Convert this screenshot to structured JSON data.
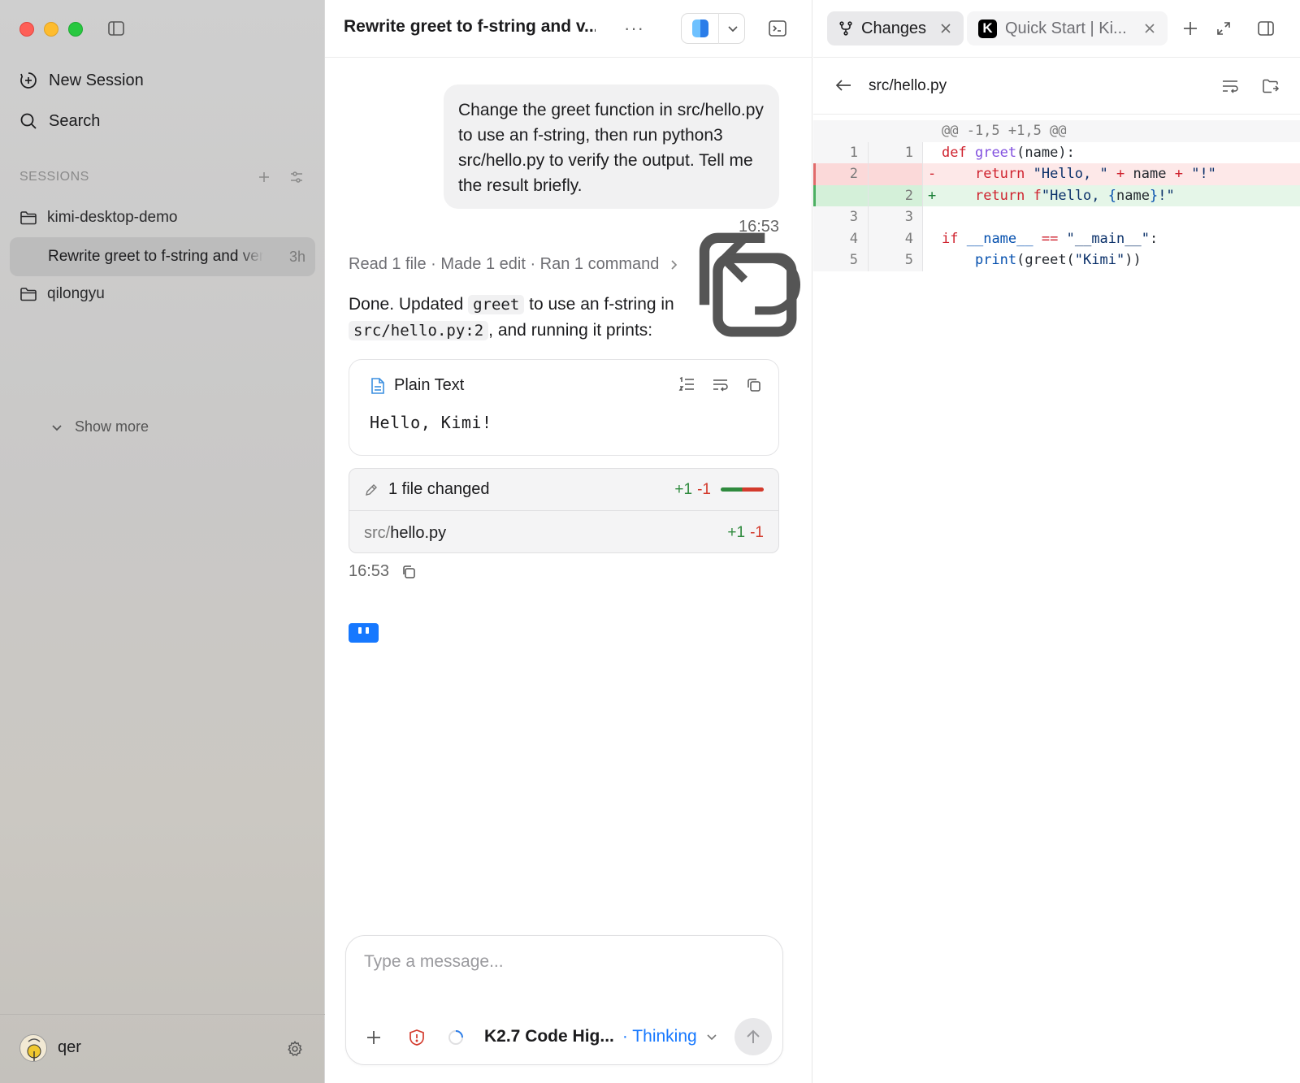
{
  "sidebar": {
    "new_session": "New Session",
    "search": "Search",
    "sessions_label": "SESSIONS",
    "folders": [
      {
        "name": "kimi-desktop-demo"
      },
      {
        "name": "qilongyu"
      }
    ],
    "active_session": {
      "title": "Rewrite greet to f-string and verify",
      "age": "3h"
    },
    "show_more": "Show more",
    "user": {
      "name": "qer"
    }
  },
  "chat": {
    "title": "Rewrite greet to f-string and v...",
    "more": "···",
    "user_message": "Change the greet function in src/hello.py to use an f-string, then run python3 src/hello.py to verify the output. Tell me the result briefly.",
    "user_message_time": "16:53",
    "activity": "Read 1 file · Made 1 edit · Ran 1 command",
    "reply": {
      "part1": "Done. Updated ",
      "code1": "greet",
      "part2": " to use an f-string in ",
      "code2": "src/hello.py:2",
      "part3": ", and running it prints:"
    },
    "code_block": {
      "language": "Plain Text",
      "content": "Hello, Kimi!"
    },
    "files_changed": {
      "title": "1 file changed",
      "additions": "+1",
      "deletions": "-1",
      "file_dir": "src/",
      "file_name": "hello.py",
      "file_additions": "+1",
      "file_deletions": "-1"
    },
    "reply_time": "16:53",
    "composer": {
      "placeholder": "Type a message...",
      "model": "K2.7 Code Hig...",
      "mode": "· Thinking"
    }
  },
  "right_pane": {
    "tabs": [
      {
        "label": "Changes"
      },
      {
        "label": "Quick Start | Ki...",
        "logo": "K"
      }
    ],
    "file_path": "src/hello.py",
    "diff": {
      "hunk": "@@ -1,5 +1,5 @@",
      "lines": [
        {
          "old": "1",
          "new": "1",
          "sign": " ",
          "type": "ctx"
        },
        {
          "old": "2",
          "new": "",
          "sign": "-",
          "type": "del"
        },
        {
          "old": "",
          "new": "2",
          "sign": "+",
          "type": "add"
        },
        {
          "old": "3",
          "new": "3",
          "sign": " ",
          "type": "ctx"
        },
        {
          "old": "4",
          "new": "4",
          "sign": " ",
          "type": "ctx"
        },
        {
          "old": "5",
          "new": "5",
          "sign": " ",
          "type": "ctx"
        }
      ],
      "code": {
        "l1_kw": "def",
        "l1_fn": "greet",
        "l1_rest": "(name):",
        "l2_kw": "return",
        "l2_s1": "\"Hello, \"",
        "l2_op1": "+",
        "l2_name": "name",
        "l2_op2": "+",
        "l2_s2": "\"!\"",
        "l3_kw": "return",
        "l3_f": "f",
        "l3_s1": "\"Hello, ",
        "l3_brace": "{",
        "l3_name": "name",
        "l3_brace2": "}",
        "l3_s2": "!\"",
        "l5_kw": "if",
        "l5_name": "__name__",
        "l5_op": "==",
        "l5_s": "\"__main__\"",
        "l5_rest": ":",
        "l6_bi": "print",
        "l6_rest1": "(greet(",
        "l6_s": "\"Kimi\"",
        "l6_rest2": "))"
      }
    }
  }
}
